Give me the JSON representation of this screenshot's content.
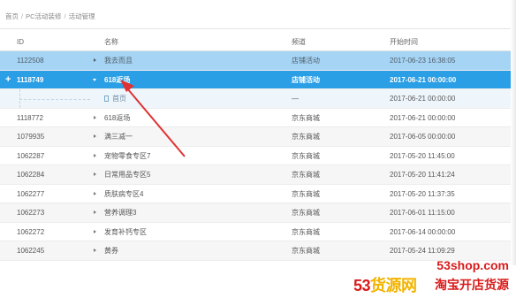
{
  "breadcrumb": [
    "首页",
    "PC活动装修",
    "活动管理"
  ],
  "table": {
    "columns": [
      "ID",
      "名称",
      "频道",
      "开始时间"
    ],
    "rows": [
      {
        "id": "1122508",
        "name": "我去而且",
        "channel": "店铺活动",
        "start": "2017-06-23 16:38:05",
        "state": "light",
        "caret": "right"
      },
      {
        "id": "1118749",
        "name": "618返场",
        "channel": "店铺活动",
        "start": "2017-06-21 00:00:00",
        "state": "selected",
        "caret": "down",
        "expander": "+"
      },
      {
        "id": "",
        "name": "首页",
        "channel": "—",
        "start": "2017-06-21 00:00:00",
        "state": "sub",
        "icon": "page-icon"
      },
      {
        "id": "1118772",
        "name": "618返场",
        "channel": "京东商城",
        "start": "2017-06-21 00:00:00",
        "state": "normal",
        "caret": "right"
      },
      {
        "id": "1079935",
        "name": "满三减一",
        "channel": "京东商城",
        "start": "2017-06-05 00:00:00",
        "state": "striped",
        "caret": "right"
      },
      {
        "id": "1062287",
        "name": "宠物零食专区7",
        "channel": "京东商城",
        "start": "2017-05-20 11:45:00",
        "state": "normal",
        "caret": "right"
      },
      {
        "id": "1062284",
        "name": "日常用品专区5",
        "channel": "京东商城",
        "start": "2017-05-20 11:41:24",
        "state": "striped",
        "caret": "right"
      },
      {
        "id": "1062277",
        "name": "质肤病专区4",
        "channel": "京东商城",
        "start": "2017-05-20 11:37:35",
        "state": "normal",
        "caret": "right"
      },
      {
        "id": "1062273",
        "name": "营养调理3",
        "channel": "京东商城",
        "start": "2017-06-01 11:15:00",
        "state": "striped",
        "caret": "right"
      },
      {
        "id": "1062272",
        "name": "发育补钙专区",
        "channel": "京东商城",
        "start": "2017-06-14 00:00:00",
        "state": "normal",
        "caret": "right"
      },
      {
        "id": "1062245",
        "name": "黄券",
        "channel": "京东商城",
        "start": "2017-05-24 11:09:29",
        "state": "striped",
        "caret": "right"
      }
    ]
  },
  "annotation": {
    "arrow_color": "#e03232"
  },
  "watermark": {
    "site": "53shop.com",
    "brand_num": "53",
    "brand_text": "货源网",
    "slogan": "淘宝开店货源"
  },
  "colors": {
    "selected_row": "#2a9fe6",
    "highlight_row": "#a6d4f4",
    "brand_red": "#d81b1b"
  }
}
